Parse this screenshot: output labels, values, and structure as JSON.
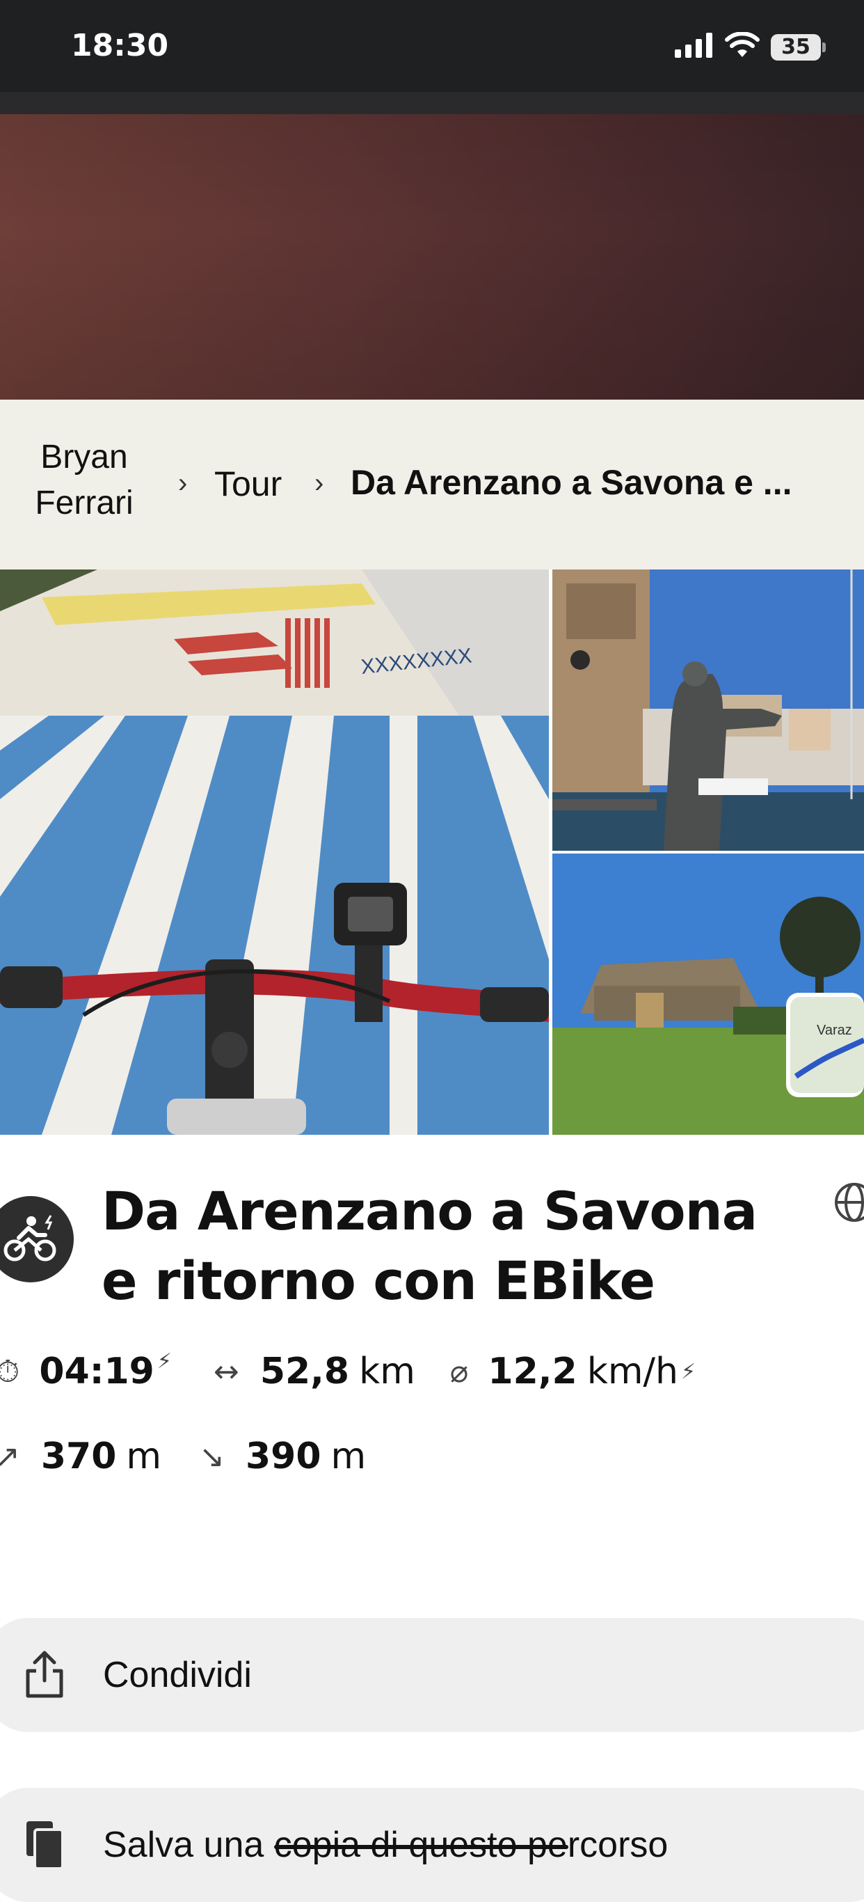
{
  "status_bar": {
    "time": "18:30",
    "battery": "35"
  },
  "breadcrumb": {
    "user": "Bryan Ferrari",
    "section": "Tour",
    "current": "Da Arenzano a Savona e ..."
  },
  "photos": {
    "map_thumb_label": "Varaz"
  },
  "tour": {
    "title": "Da Arenzano a Savona e ritorno con EBike",
    "icon": "ebike-icon"
  },
  "stats": {
    "duration": "04:19",
    "distance_value": "52,8",
    "distance_unit": "km",
    "speed_value": "12,2",
    "speed_unit": "km/h",
    "ascent_value": "370",
    "ascent_unit": "m",
    "descent_value": "390",
    "descent_unit": "m"
  },
  "actions": {
    "share_label": "Condividi",
    "save_prefix": "Salva una ",
    "save_struck": "copia di questo p",
    "save_suffix": "ercorso"
  },
  "colors": {
    "status_bar_bg": "#1f2022",
    "breadcrumb_bg": "#f1f0e8",
    "action_bg": "#efefef"
  }
}
